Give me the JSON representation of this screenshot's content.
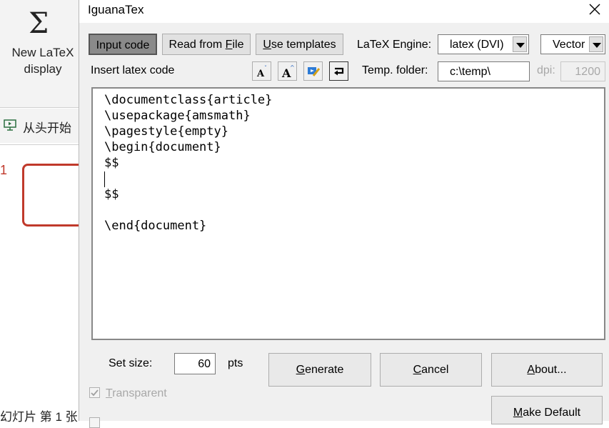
{
  "background": {
    "ribbon_button_label": "New LaTeX display",
    "ribbon_line1": "New LaTeX",
    "ribbon_line2": "display",
    "start_from_beginning": "从头开始",
    "slide_number": "1",
    "status_bar": "幻灯片 第 1 张"
  },
  "dialog": {
    "title": "IguanaTex",
    "tabs": {
      "input_code": "Input code",
      "read_from_file_prefix": "Read from ",
      "read_from_file_key": "F",
      "read_from_file_suffix": "ile",
      "use_templates_key": "U",
      "use_templates_suffix": "se templates"
    },
    "engine_label": "LaTeX Engine:",
    "engine_value": "latex (DVI)",
    "output_value": "Vector",
    "insert_label": "Insert latex code",
    "temp_folder_label": "Temp. folder:",
    "temp_folder_value": "c:\\temp\\",
    "dpi_label": "dpi:",
    "dpi_value": "1200",
    "code_lines": [
      "\\documentclass{article}",
      "\\usepackage{amsmath}",
      "\\pagestyle{empty}",
      "\\begin{document}",
      "$$",
      "",
      "$$",
      "",
      "\\end{document}"
    ],
    "set_size_label": "Set size:",
    "size_value": "60",
    "pts_label": "pts",
    "generate_key": "G",
    "generate_suffix": "enerate",
    "cancel_key": "C",
    "cancel_suffix": "ancel",
    "about_key": "A",
    "about_suffix": "bout...",
    "transparent_key": "T",
    "transparent_suffix": "ransparent",
    "make_default_key": "M",
    "make_default_suffix": "ake Default"
  },
  "colors": {
    "accent_red": "#c0392b",
    "dialog_bg": "#f0f0f0",
    "button_bg": "#e1e1e1"
  }
}
